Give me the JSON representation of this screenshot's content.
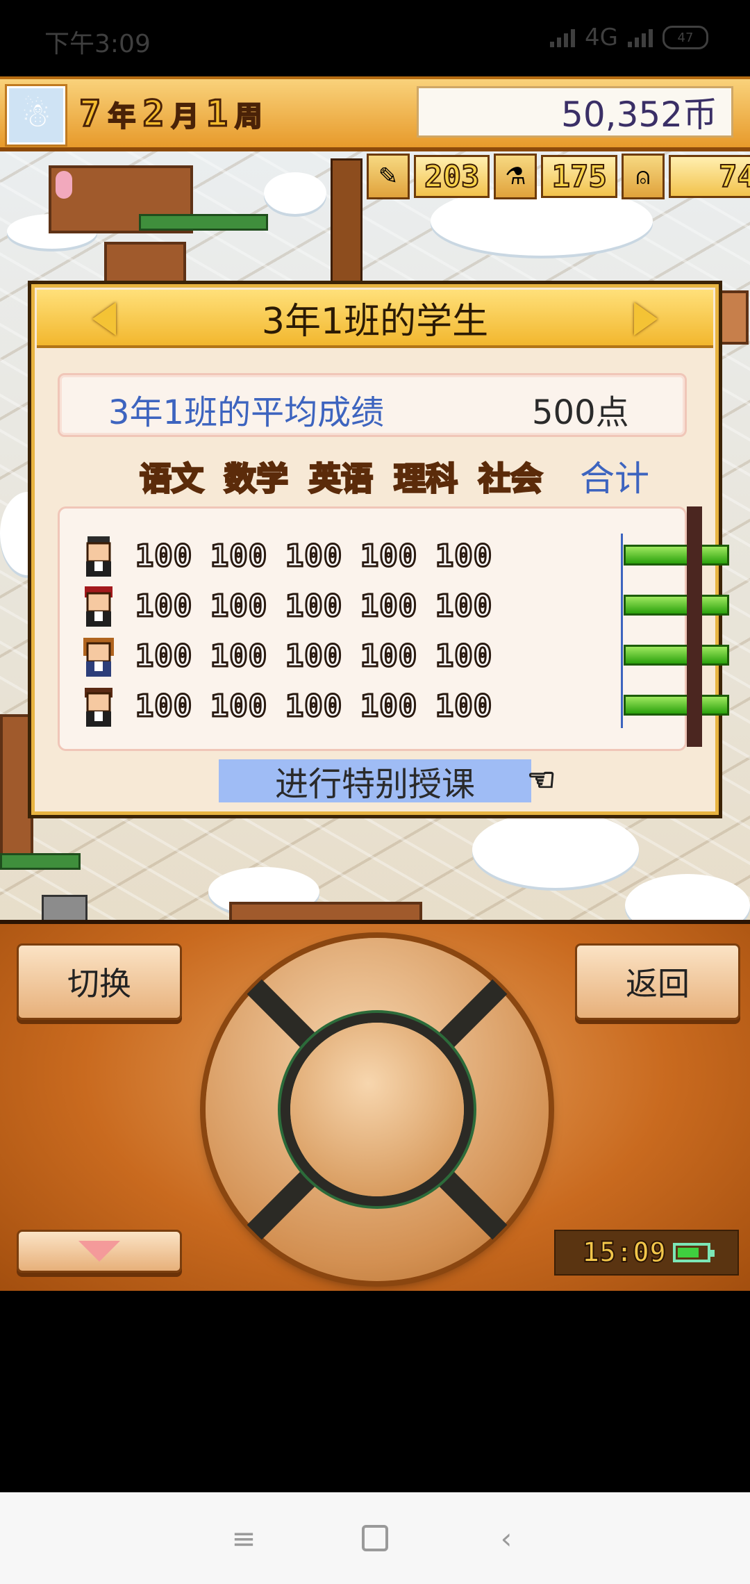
{
  "status_bar": {
    "time": "下午3:09",
    "network": "4G",
    "battery": "47"
  },
  "header": {
    "year": "7",
    "year_unit": "年",
    "month": "2",
    "month_unit": "月",
    "week": "1",
    "week_unit": "周",
    "money": "50,352币"
  },
  "stats": {
    "stat1": "203",
    "stat2": "175",
    "stat3": "74"
  },
  "dialog": {
    "title": "3年1班的学生",
    "avg_label": "3年1班的平均成绩",
    "avg_value": "500点",
    "subjects": [
      "语文",
      "数学",
      "英语",
      "理科",
      "社会"
    ],
    "total_label": "合计",
    "students": [
      {
        "scores": [
          "100",
          "100",
          "100",
          "100",
          "100"
        ],
        "total_fill": 1.0
      },
      {
        "scores": [
          "100",
          "100",
          "100",
          "100",
          "100"
        ],
        "total_fill": 1.0
      },
      {
        "scores": [
          "100",
          "100",
          "100",
          "100",
          "100"
        ],
        "total_fill": 1.0
      },
      {
        "scores": [
          "100",
          "100",
          "100",
          "100",
          "100"
        ],
        "total_fill": 1.0
      }
    ],
    "special_lesson": "进行特别授课"
  },
  "controls": {
    "switch_label": "切换",
    "back_label": "返回",
    "clock": "15:09",
    "battery_level": 0.75
  },
  "icons": {
    "nav_menu": "menu-icon",
    "nav_home": "home-icon",
    "nav_back": "back-icon"
  }
}
